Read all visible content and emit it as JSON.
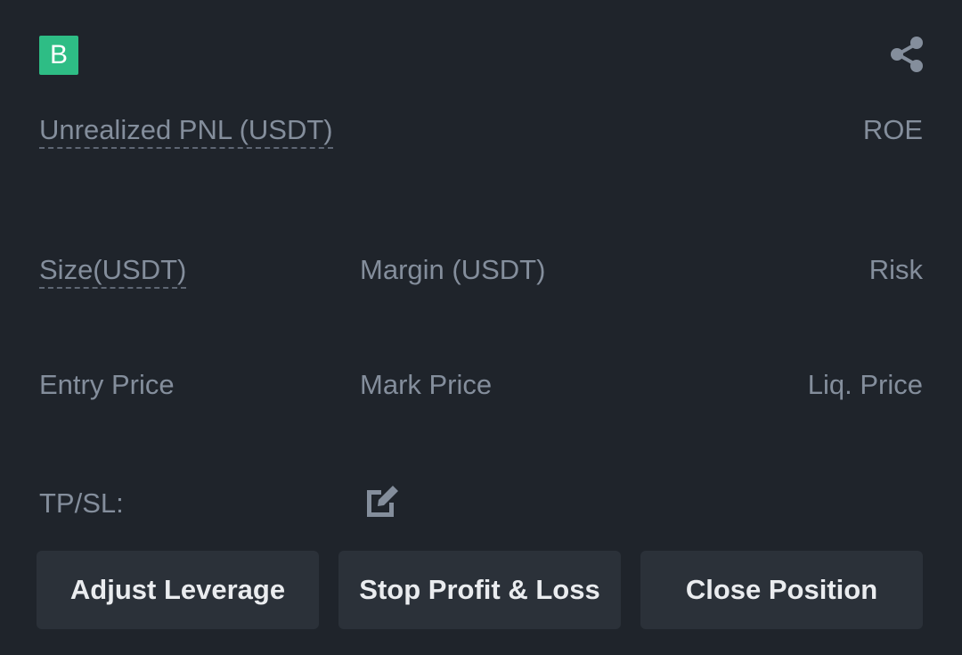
{
  "header": {
    "badge_letter": "B",
    "share_icon": "share-icon"
  },
  "metrics": {
    "unrealized_pnl_label": "Unrealized PNL (USDT)",
    "roe_label": "ROE",
    "size_label": "Size(USDT)",
    "margin_label": "Margin (USDT)",
    "risk_label": "Risk",
    "entry_price_label": "Entry Price",
    "mark_price_label": "Mark Price",
    "liq_price_label": "Liq. Price"
  },
  "tpsl": {
    "label": "TP/SL:",
    "edit_icon": "edit-icon"
  },
  "actions": {
    "adjust_leverage": "Adjust Leverage",
    "stop_profit_loss": "Stop Profit & Loss",
    "close_position": "Close Position"
  },
  "colors": {
    "background": "#1f242b",
    "badge": "#2ebd85",
    "label_text": "#848e9c",
    "button_bg": "#2b3139",
    "button_text": "#eaecef"
  }
}
